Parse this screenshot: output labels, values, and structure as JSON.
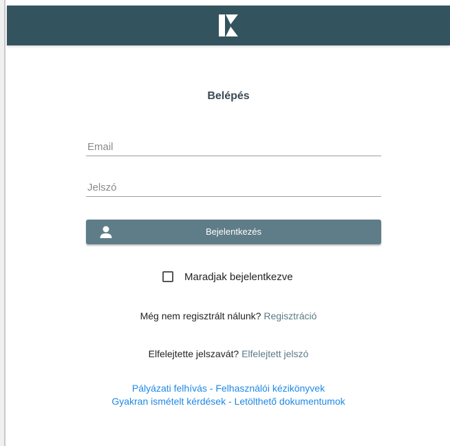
{
  "header": {
    "logo_alt": "K",
    "background_color": "#33535f"
  },
  "login": {
    "title": "Belépés",
    "email_placeholder": "Email",
    "password_placeholder": "Jelszó",
    "submit_label": "Bejelentkezés",
    "button_color": "#5f7d88",
    "remember_label": "Maradjak bejelentkezve",
    "remember_checked": false
  },
  "register": {
    "prompt": "Még nem regisztrált nálunk?",
    "link": "Regisztráció"
  },
  "forgot": {
    "prompt": "Elfelejtette jelszavát?",
    "link": "Elfelejtett jelszó"
  },
  "footer_links": {
    "row1": [
      "Pályázati felhívás",
      "Felhasználói kézikönyvek"
    ],
    "row2": [
      "Gyakran ismételt kérdések",
      "Letölthető dokumentumok"
    ],
    "separator": "-",
    "link_color": "#1e88e5"
  }
}
